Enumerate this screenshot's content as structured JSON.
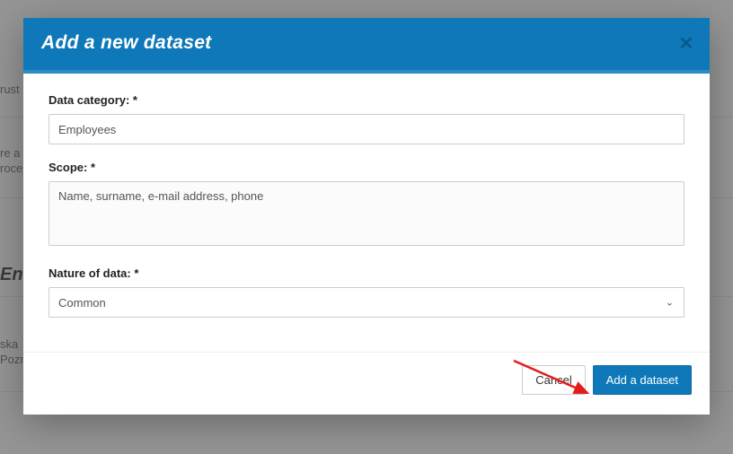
{
  "background": {
    "line1": "rust",
    "line2a": "re a",
    "line2b": "roce",
    "section_header": "Ent",
    "line3a": "ska",
    "line3b": "Pozn"
  },
  "modal": {
    "title": "Add a new dataset",
    "close_symbol": "✕",
    "fields": {
      "data_category": {
        "label": "Data category: *",
        "value": "Employees"
      },
      "scope": {
        "label": "Scope: *",
        "value": "Name, surname, e-mail address, phone"
      },
      "nature": {
        "label": "Nature of data: *",
        "value": "Common"
      }
    },
    "footer": {
      "cancel": "Cancel",
      "submit": "Add a dataset"
    }
  }
}
